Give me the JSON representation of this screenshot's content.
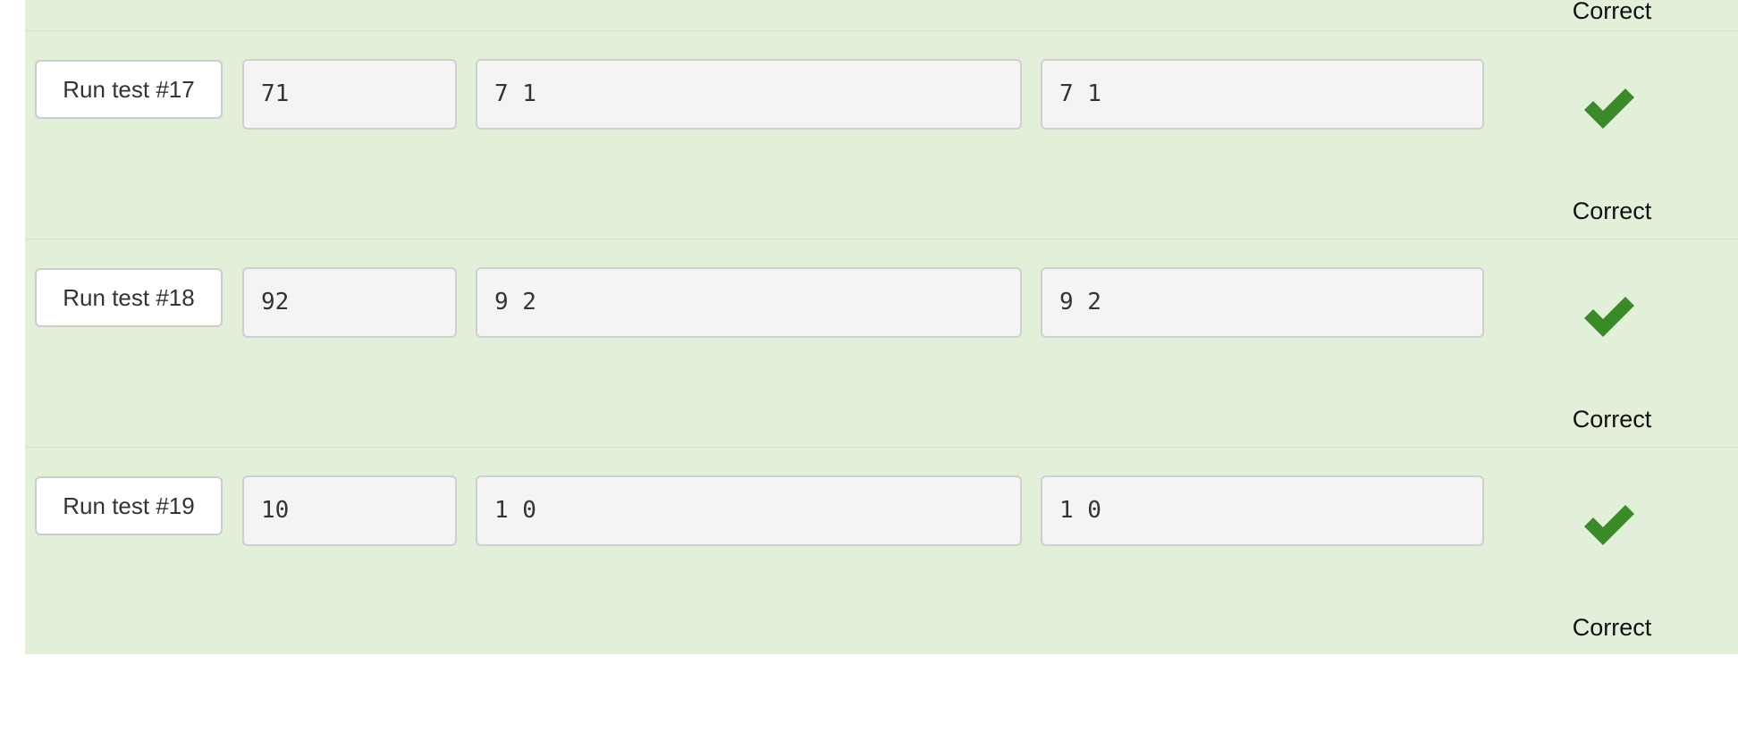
{
  "colors": {
    "row_background": "#e2efd9",
    "check_green": "#3a8a2a"
  },
  "rows": [
    {
      "status": "Correct",
      "status_icon": "checkmark-icon"
    },
    {
      "button_label": "Run test #17",
      "input": "71",
      "expected": "7 1",
      "got": "7 1",
      "status": "Correct",
      "status_icon": "checkmark-icon"
    },
    {
      "button_label": "Run test #18",
      "input": "92",
      "expected": "9 2",
      "got": "9 2",
      "status": "Correct",
      "status_icon": "checkmark-icon"
    },
    {
      "button_label": "Run test #19",
      "input": "10",
      "expected": "1 0",
      "got": "1 0",
      "status": "Correct",
      "status_icon": "checkmark-icon"
    }
  ]
}
